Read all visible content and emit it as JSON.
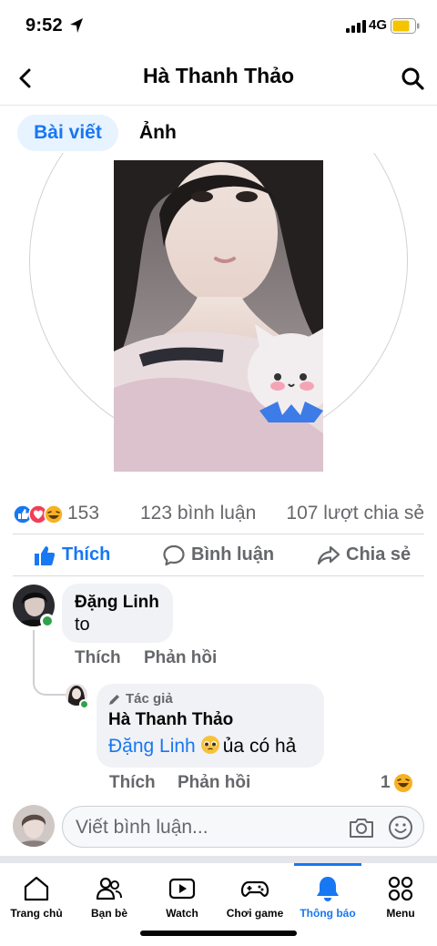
{
  "status_bar": {
    "time": "9:52",
    "network": "4G"
  },
  "header": {
    "title": "Hà Thanh Thảo"
  },
  "tabs": [
    {
      "label": "Bài viết",
      "active": true
    },
    {
      "label": "Ảnh",
      "active": false
    }
  ],
  "post": {
    "reaction_count": "153",
    "comment_count": "123 bình luận",
    "share_count": "107 lượt chia sẻ",
    "actions": {
      "like": "Thích",
      "comment": "Bình luận",
      "share": "Chia sẻ"
    }
  },
  "comments": [
    {
      "author": "Đặng Linh",
      "text": "to",
      "like_label": "Thích",
      "reply_label": "Phản hồi",
      "replies": [
        {
          "badge": "Tác giả",
          "author": "Hà Thanh Thảo",
          "mention": "Đặng Linh",
          "text": "ủa có hả",
          "like_label": "Thích",
          "reply_label": "Phản hồi",
          "reaction_count": "1"
        }
      ]
    }
  ],
  "composer": {
    "placeholder": "Viết bình luận..."
  },
  "tab_bar": {
    "active_index": 4,
    "items": [
      {
        "label": "Trang chủ",
        "icon": "home-icon"
      },
      {
        "label": "Bạn bè",
        "icon": "friends-icon"
      },
      {
        "label": "Watch",
        "icon": "watch-icon"
      },
      {
        "label": "Chơi game",
        "icon": "gaming-icon"
      },
      {
        "label": "Thông báo",
        "icon": "bell-icon"
      },
      {
        "label": "Menu",
        "icon": "menu-grid-icon"
      }
    ]
  },
  "colors": {
    "accent": "#1877f2",
    "secondary_text": "#65676b",
    "bubble": "#f0f2f5",
    "online": "#31a24c"
  }
}
